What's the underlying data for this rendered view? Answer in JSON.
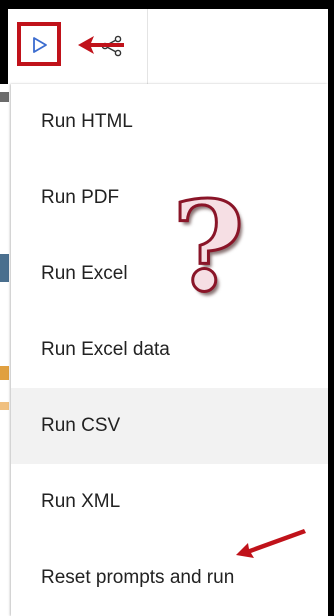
{
  "menu": {
    "items": [
      {
        "label": "Run HTML"
      },
      {
        "label": "Run PDF"
      },
      {
        "label": "Run Excel"
      },
      {
        "label": "Run Excel data"
      },
      {
        "label": "Run CSV",
        "highlighted": true
      },
      {
        "label": "Run XML"
      },
      {
        "label": "Reset prompts and run"
      }
    ]
  },
  "toolbar": {
    "run_icon": "play-triangle-icon",
    "share_icon": "share-nodes-icon"
  },
  "annotation": {
    "symbol": "?",
    "arrow_color": "#c0121a",
    "highlight_color": "#c0121a"
  },
  "colors": {
    "accent_blue": "#3b6ccf",
    "hover_row": "#f2f2f2"
  }
}
